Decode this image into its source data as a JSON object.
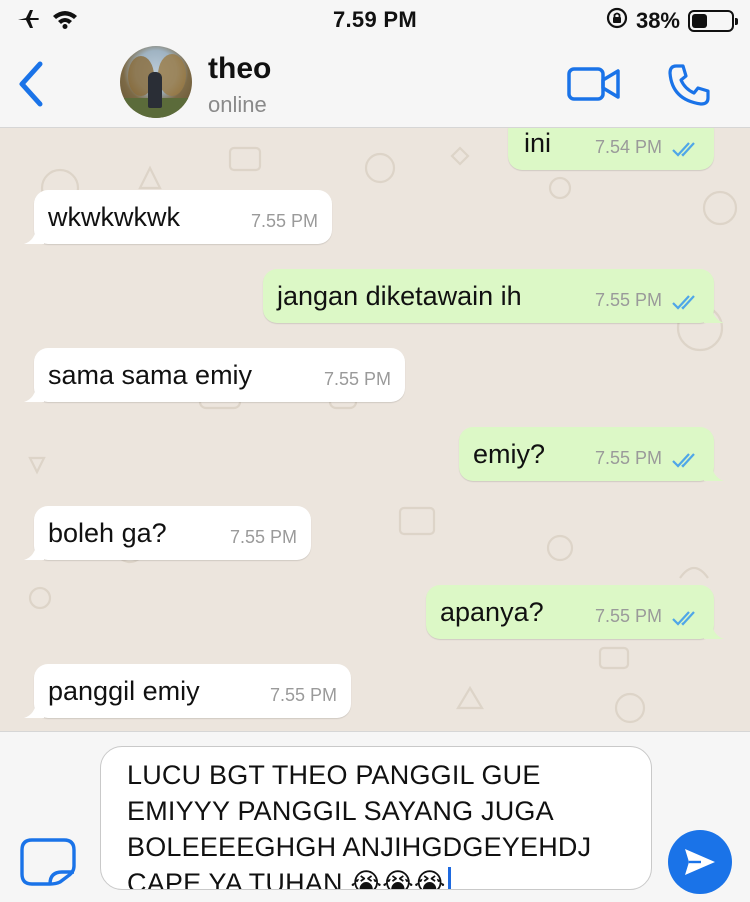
{
  "status_bar": {
    "time": "7.59 PM",
    "battery": "38%"
  },
  "header": {
    "contact_name": "theo",
    "contact_status": "online"
  },
  "messages": [
    {
      "direction": "out",
      "text": "ini",
      "time": "7.54 PM",
      "read": true
    },
    {
      "direction": "in",
      "text": "wkwkwkwk",
      "time": "7.55 PM"
    },
    {
      "direction": "out",
      "text": "jangan diketawain ih",
      "time": "7.55 PM",
      "read": true
    },
    {
      "direction": "in",
      "text": "sama sama emiy",
      "time": "7.55 PM"
    },
    {
      "direction": "out",
      "text": "emiy?",
      "time": "7.55 PM",
      "read": true
    },
    {
      "direction": "in",
      "text": "boleh ga?",
      "time": "7.55 PM"
    },
    {
      "direction": "out",
      "text": "apanya?",
      "time": "7.55 PM",
      "read": true
    },
    {
      "direction": "in",
      "text": "panggil emiy",
      "time": "7.55 PM"
    }
  ],
  "composer": {
    "lines": [
      "LUCU BGT THEO PANGGIL GUE",
      "EMIYYY PANGGIL SAYANG JUGA",
      "BOLEEEEGHGH ANJIHGDGEYEHDJ",
      "CAPE YA TUHAN 😭😭😭"
    ]
  },
  "colors": {
    "accent": "#1a73e8",
    "outgoing_bubble": "#dcf8c6",
    "incoming_bubble": "#ffffff",
    "chat_background": "#ece5dd",
    "read_ticks": "#4fa6e8"
  }
}
